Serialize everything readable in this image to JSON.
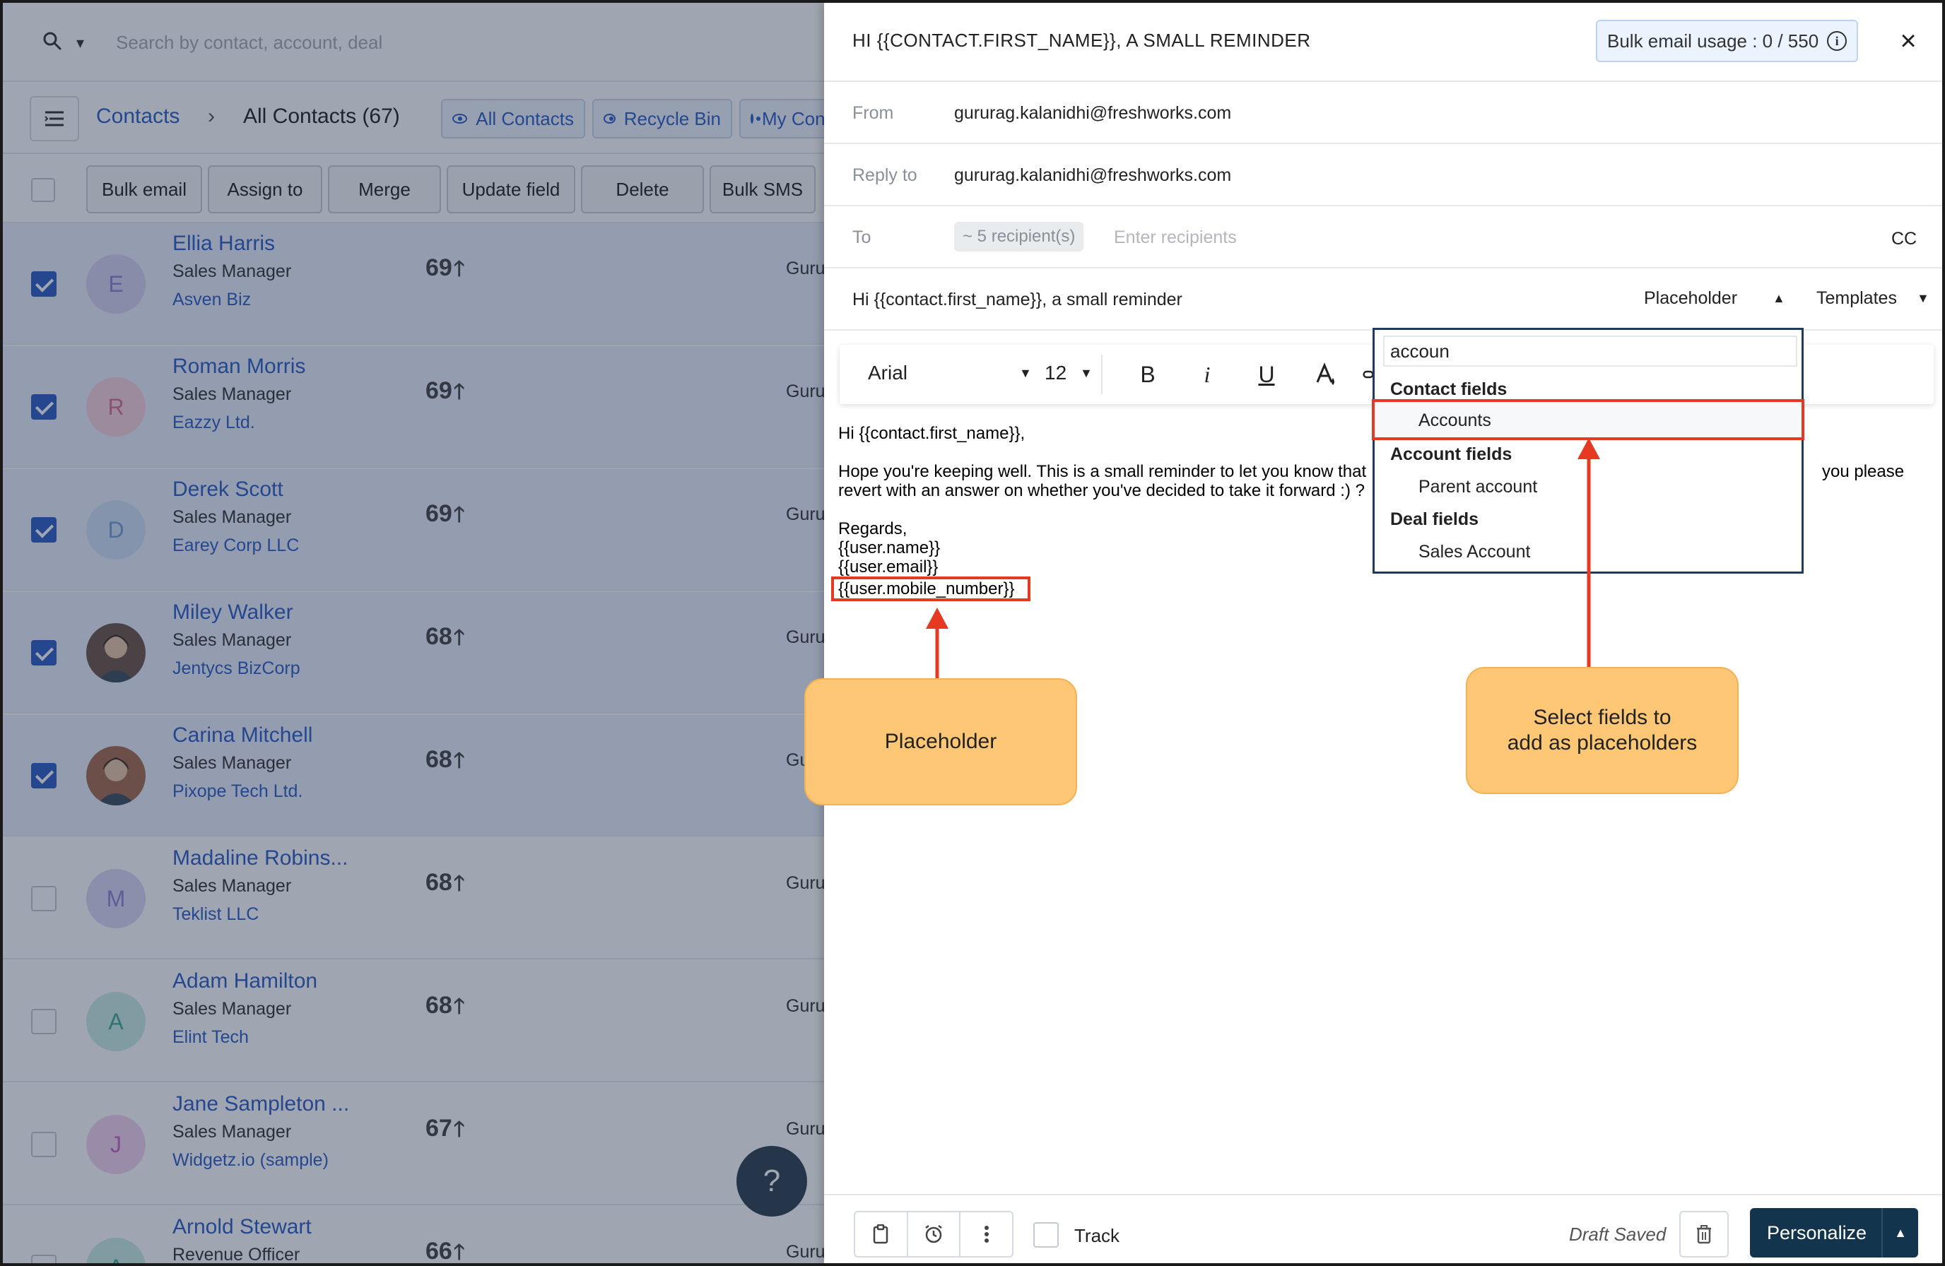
{
  "search": {
    "placeholder": "Search by contact, account, deal"
  },
  "breadcrumb": {
    "root": "Contacts",
    "separator": "›",
    "current": "All Contacts (67)"
  },
  "view_tabs": [
    {
      "label": "All Contacts"
    },
    {
      "label": "Recycle Bin"
    },
    {
      "label": "My Contacts"
    }
  ],
  "actions": [
    {
      "label": "Bulk email"
    },
    {
      "label": "Assign to"
    },
    {
      "label": "Merge"
    },
    {
      "label": "Update field"
    },
    {
      "label": "Delete"
    },
    {
      "label": "Bulk SMS"
    }
  ],
  "contacts": [
    {
      "initial": "E",
      "name": "Ellia Harris",
      "title": "Sales Manager",
      "company": "Asven Biz",
      "score": "69",
      "owner": "Gurur",
      "selected": true,
      "avatar_color": "#d8d2f2",
      "initial_color": "#8f82d4"
    },
    {
      "initial": "R",
      "name": "Roman Morris",
      "title": "Sales Manager",
      "company": "Eazzy Ltd.",
      "score": "69",
      "owner": "Gurur",
      "selected": true,
      "avatar_color": "#f7d0dc",
      "initial_color": "#d96b8e"
    },
    {
      "initial": "D",
      "name": "Derek Scott",
      "title": "Sales Manager",
      "company": "Earey Corp LLC",
      "score": "69",
      "owner": "Gurur",
      "selected": true,
      "avatar_color": "#cde0f7",
      "initial_color": "#6e9fd6"
    },
    {
      "initial": "",
      "name": "Miley Walker",
      "title": "Sales Manager",
      "company": "Jentycs BizCorp",
      "score": "68",
      "owner": "Gurur",
      "selected": true,
      "avatar_color": "#6b5446",
      "initial_color": "#ffffff"
    },
    {
      "initial": "",
      "name": "Carina Mitchell",
      "title": "Sales Manager",
      "company": "Pixope Tech Ltd.",
      "score": "68",
      "owner": "Gu",
      "selected": true,
      "avatar_color": "#a86a4d",
      "initial_color": "#ffffff"
    },
    {
      "initial": "M",
      "name": "Madaline Robins...",
      "title": "Sales Manager",
      "company": "Teklist LLC",
      "score": "68",
      "owner": "Gurur",
      "selected": false,
      "avatar_color": "#ddd7f5",
      "initial_color": "#8f82d4"
    },
    {
      "initial": "A",
      "name": "Adam Hamilton",
      "title": "Sales Manager",
      "company": "Elint Tech",
      "score": "68",
      "owner": "Gurur",
      "selected": false,
      "avatar_color": "#c9ece6",
      "initial_color": "#3fa892"
    },
    {
      "initial": "J",
      "name": "Jane Sampleton ...",
      "title": "Sales Manager",
      "company": "Widgetz.io (sample)",
      "score": "67",
      "owner": "Gurur",
      "selected": false,
      "avatar_color": "#f2d3ef",
      "initial_color": "#c864bd"
    },
    {
      "initial": "A",
      "name": "Arnold Stewart",
      "title": "Revenue Officer",
      "company": "",
      "score": "66",
      "owner": "Gurur",
      "selected": false,
      "avatar_color": "#c9ece6",
      "initial_color": "#3fa892"
    }
  ],
  "help": {
    "label": "?"
  },
  "composer": {
    "title": "HI {{CONTACT.FIRST_NAME}}, A SMALL REMINDER",
    "usage": "Bulk email usage : 0 / 550",
    "usage_info": "i",
    "close": "×",
    "from_label": "From",
    "from_value": "gururag.kalanidhi@freshworks.com",
    "reply_label": "Reply to",
    "reply_value": "gururag.kalanidhi@freshworks.com",
    "to_label": "To",
    "recipients_chip": "~ 5 recipient(s)",
    "recipients_placeholder": "Enter recipients",
    "cc": "CC",
    "subject": "Hi {{contact.first_name}}, a small reminder",
    "placeholder_menu": "Placeholder",
    "templates_menu": "Templates",
    "toolbar": {
      "font": "Arial",
      "size": "12",
      "bold": "B",
      "italic": "i",
      "underline": "U"
    },
    "body": {
      "greeting": "Hi {{contact.first_name}},",
      "line1a": "Hope you're keeping well. This is a small reminder to let you know that",
      "line1b": "you please",
      "line2": "revert with an answer on whether you've decided to take it forward :) ?",
      "regards": "Regards,",
      "user_name": "{{user.name}}",
      "user_email": "{{user.email}}",
      "user_mobile": "{{user.mobile_number}}"
    },
    "dropdown": {
      "search_value": "accoun",
      "group_contact": "Contact fields",
      "item_accounts": "Accounts",
      "group_account": "Account fields",
      "item_parent": "Parent account",
      "group_deal": "Deal fields",
      "item_sales": "Sales Account"
    },
    "footer": {
      "track": "Track",
      "draft": "Draft Saved",
      "personalize": "Personalize"
    }
  },
  "annotations": {
    "placeholder_callout": "Placeholder",
    "fields_callout": "Select fields to add as placeholders"
  },
  "colors": {
    "brand_blue": "#2c5cc5",
    "dark_navy": "#12344d",
    "annotation_red": "#e53a21",
    "callout_orange": "#fec775"
  }
}
